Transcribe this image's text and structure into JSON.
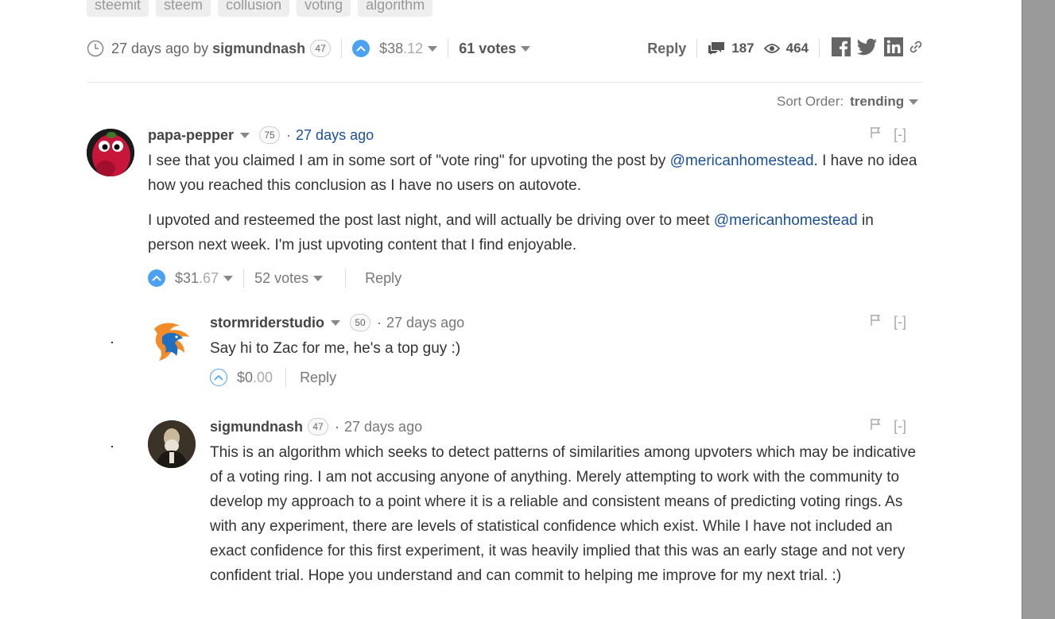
{
  "tags": [
    "steemit",
    "steem",
    "collusion",
    "voting",
    "algorithm"
  ],
  "post_meta": {
    "time": "27 days ago by",
    "author": "sigmundnash",
    "reputation": "47",
    "payout_whole": "$38",
    "payout_frac": ".12",
    "votes": "61 votes",
    "reply": "Reply",
    "comments_count": "187",
    "views_count": "464"
  },
  "sort": {
    "label": "Sort Order:",
    "value": "trending"
  },
  "comments": [
    {
      "author": "papa-pepper",
      "reputation": "75",
      "time": "27 days ago",
      "para1_pre": "I see that you claimed I am in some sort of \"vote ring\" for upvoting the post by ",
      "para1_mention": "@mericanhomestead",
      "para1_post": ". I have no idea how you reached this conclusion as I have no users on autovote.",
      "para2_pre": "I upvoted and resteemed the post last night, and will actually be driving over to meet ",
      "para2_mention": "@mericanhomestead",
      "para2_post": " in person next week. I'm just upvoting content that I find enjoyable.",
      "payout_whole": "$31",
      "payout_frac": ".67",
      "votes": "52 votes",
      "reply": "Reply",
      "collapse": "[-]"
    },
    {
      "author": "stormriderstudio",
      "reputation": "50",
      "time": "27 days ago",
      "body": "Say hi to Zac for me, he's a top guy :)",
      "payout_whole": "$0",
      "payout_frac": ".00",
      "reply": "Reply",
      "collapse": "[-]"
    },
    {
      "author": "sigmundnash",
      "reputation": "47",
      "time": "27 days ago",
      "body": "This is an algorithm which seeks to detect patterns of similarities among upvoters which may be indicative of a voting ring. I am not accusing anyone of anything. Merely attempting to work with the community to develop my approach to a point where it is a reliable and consistent means of predicting voting rings. As with any experiment, there are levels of statistical confidence which exist. While I have not included an exact confidence for this first experiment, it was heavily implied that this was an early stage and not very confident trial. Hope you understand and can commit to helping me improve for my next trial. :)",
      "collapse": "[-]"
    }
  ],
  "colors": {
    "accent_blue": "#4ba2f2",
    "link_blue": "#1a5099",
    "gutter": "#9a9a9a"
  }
}
